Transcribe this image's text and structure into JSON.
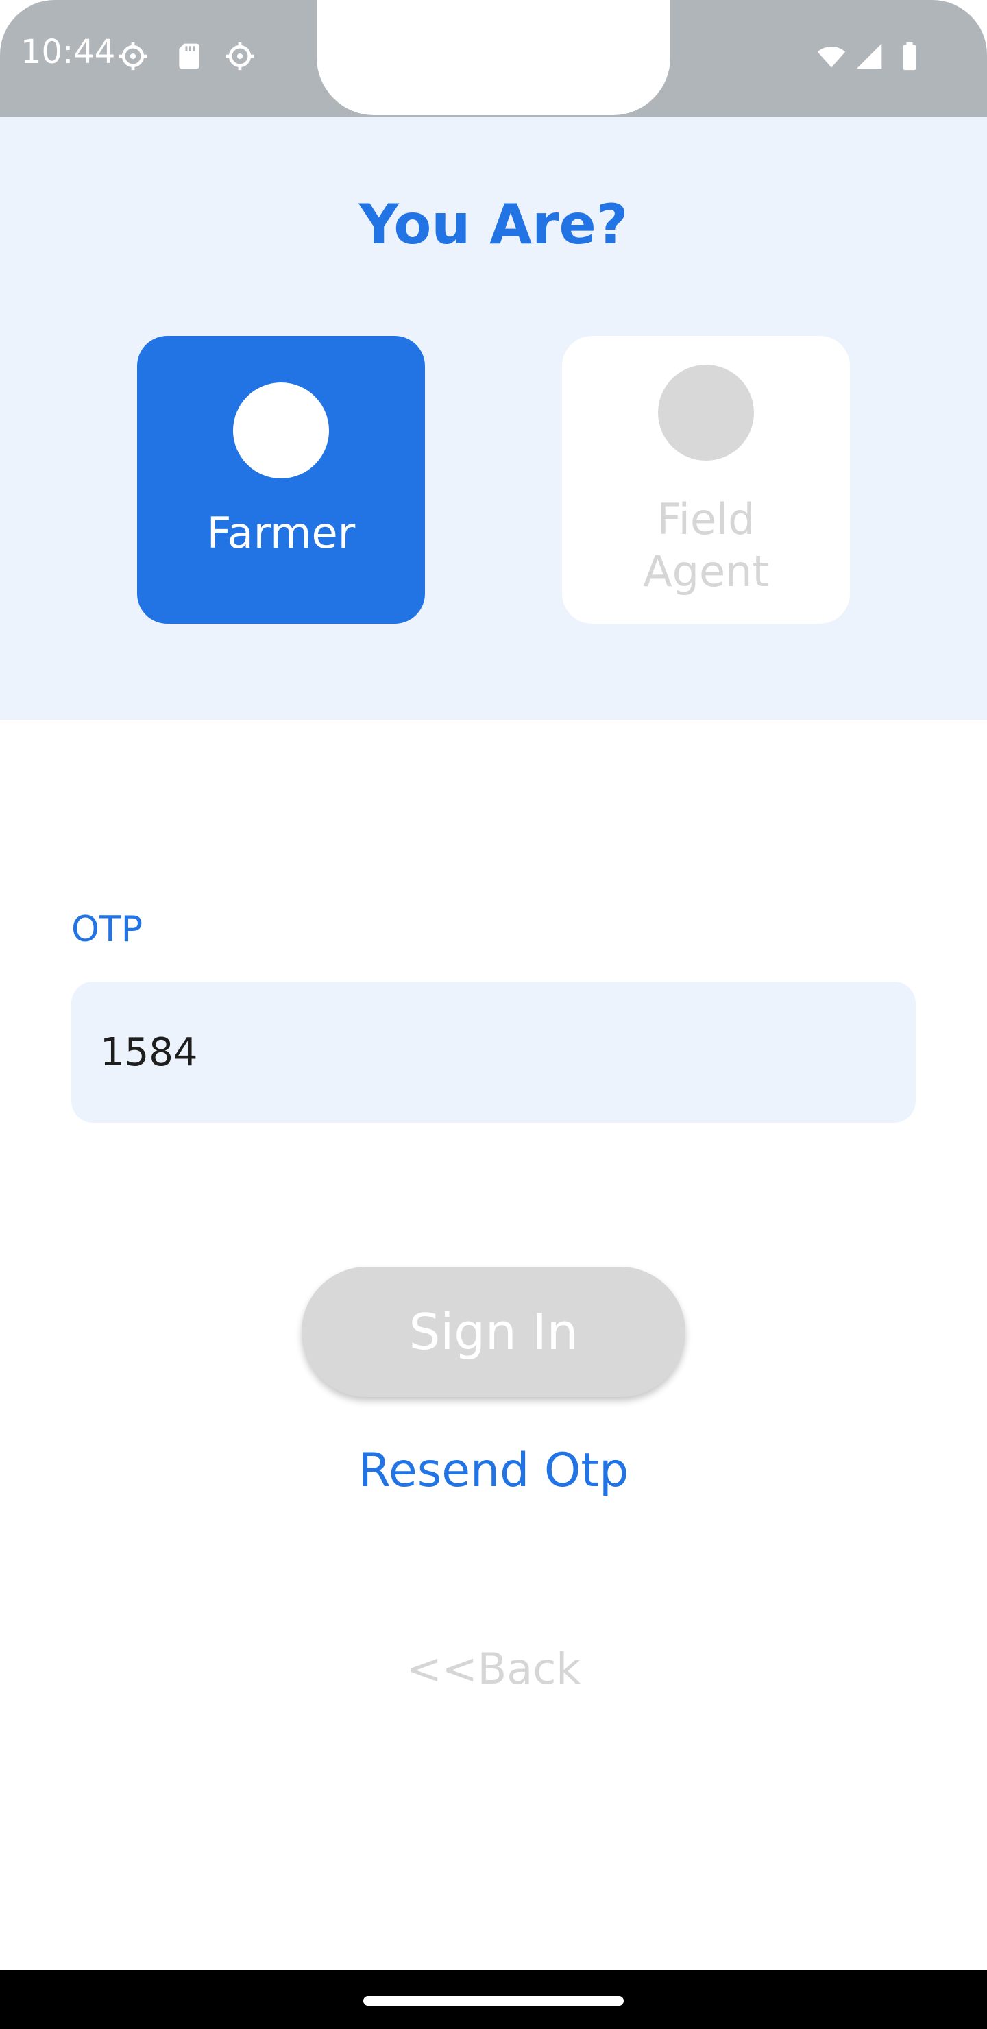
{
  "status_bar": {
    "time": "10:44",
    "icons": [
      "settings-icon",
      "sd-card-icon",
      "settings-icon",
      "wifi-icon",
      "cellular-signal-icon",
      "battery-icon"
    ]
  },
  "role_selection": {
    "title": "You Are?",
    "options": [
      {
        "label": "Farmer",
        "selected": true
      },
      {
        "label_line1": "Field",
        "label_line2": "Agent",
        "selected": false
      }
    ]
  },
  "otp_form": {
    "label": "OTP",
    "value": "1584",
    "sign_in_label": "Sign In",
    "resend_label": "Resend Otp",
    "back_label": "<<Back"
  },
  "colors": {
    "accent": "#2273e3",
    "panel_background": "#ecf3fc",
    "disabled": "#d8d8d8",
    "status_bar": "#b0b5ba"
  }
}
